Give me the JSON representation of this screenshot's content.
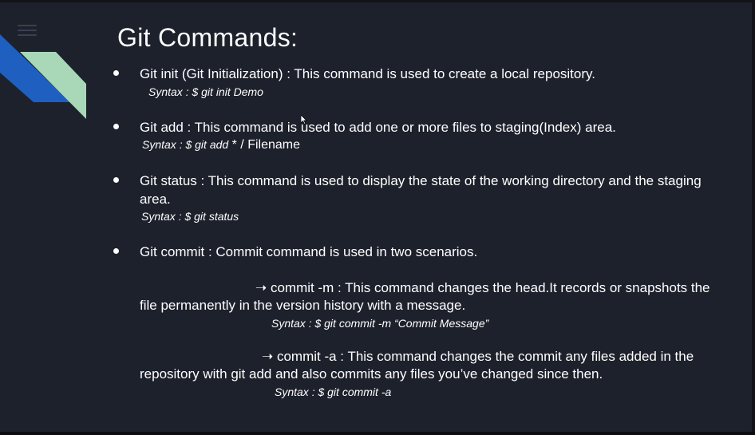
{
  "slide": {
    "title": "Git Commands:",
    "menu_icon": "hamburger-menu-icon",
    "colors": {
      "background": "#1d212c",
      "accent_blue": "#1f5fbf",
      "accent_mint": "#a8d8b8",
      "text": "#ffffff"
    },
    "items": [
      {
        "text": "Git init (Git Initialization) : This command is used to create a local repository.",
        "syntax": "Syntax :  $ git init Demo"
      },
      {
        "text": "Git add : This command is used to add one or more files to staging(Index) area.",
        "syntax_prefix": "Syntax : $ git add",
        "syntax_suffix": " * / Filename"
      },
      {
        "text_line1": "Git status : This command is used to display the state of the working directory and the staging",
        "text_line2": "area.",
        "syntax": "Syntax : $ git status"
      },
      {
        "text": "Git commit : Commit command is used in two scenarios.",
        "sub_items": [
          {
            "line1": "➝ commit  -m : This command changes the head.It records or snapshots the",
            "line2": "file permanently in the version history with a message.",
            "syntax": "Syntax : $ git commit -m “Commit Message”"
          },
          {
            "line1": "➝ commit -a : This command  changes the commit any files added in the",
            "line2": "repository with git add and also commits any files you’ve changed since then.",
            "syntax": "Syntax : $ git commit -a"
          }
        ]
      }
    ]
  }
}
